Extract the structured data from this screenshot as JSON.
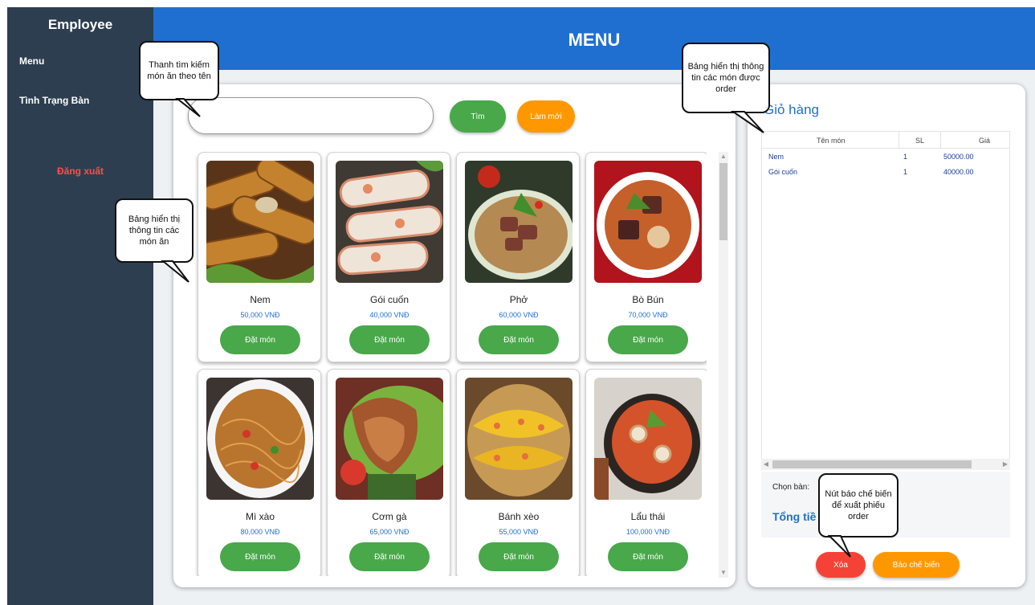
{
  "sidebar": {
    "title": "Employee",
    "items": [
      {
        "label": "Menu"
      },
      {
        "label": "Tình Trạng Bàn"
      }
    ],
    "logout": "Đăng xuất"
  },
  "header": {
    "title": "MENU"
  },
  "search": {
    "value": "",
    "placeholder": "",
    "search_button": "Tìm",
    "refresh_button": "Làm mới"
  },
  "menu_items": [
    {
      "name": "Nem",
      "price": "50,000 VNĐ",
      "button": "Đặt món"
    },
    {
      "name": "Gói cuốn",
      "price": "40,000 VNĐ",
      "button": "Đặt món"
    },
    {
      "name": "Phở",
      "price": "60,000 VNĐ",
      "button": "Đặt món"
    },
    {
      "name": "Bò Bún",
      "price": "70,000 VNĐ",
      "button": "Đặt món"
    },
    {
      "name": "Mì xào",
      "price": "80,000 VNĐ",
      "button": "Đặt món"
    },
    {
      "name": "Cơm gà",
      "price": "65,000 VNĐ",
      "button": "Đặt món"
    },
    {
      "name": "Bánh xèo",
      "price": "55,000 VNĐ",
      "button": "Đặt món"
    },
    {
      "name": "Lẩu thái",
      "price": "100,000 VNĐ",
      "button": "Đặt món"
    }
  ],
  "cart": {
    "title": "Giỏ hàng",
    "columns": [
      "Tên món",
      "SL",
      "Giá"
    ],
    "rows": [
      {
        "name": "Nem",
        "qty": "1",
        "price": "50000.00"
      },
      {
        "name": "Gói cuốn",
        "qty": "1",
        "price": "40000.00"
      }
    ],
    "table_label": "Chọn bàn:",
    "total_label": "Tổng tiề",
    "delete_button": "Xóa",
    "kitchen_button": "Báo chế biến"
  },
  "callouts": {
    "search": "Thanh tìm kiếm món ăn theo tên",
    "menu": "Bảng hiển thị thông tin các món ăn",
    "cart": "Bảng hiển thị thông tin các món được order",
    "kitchen": "Nút báo chế biến để xuất phiếu order"
  },
  "colors": {
    "sidebar": "#2d3e50",
    "header": "#1f6fd1",
    "accent_green": "#48a84a",
    "accent_orange": "#ff9800",
    "danger": "#f44336",
    "logout": "#ff4d4d"
  }
}
